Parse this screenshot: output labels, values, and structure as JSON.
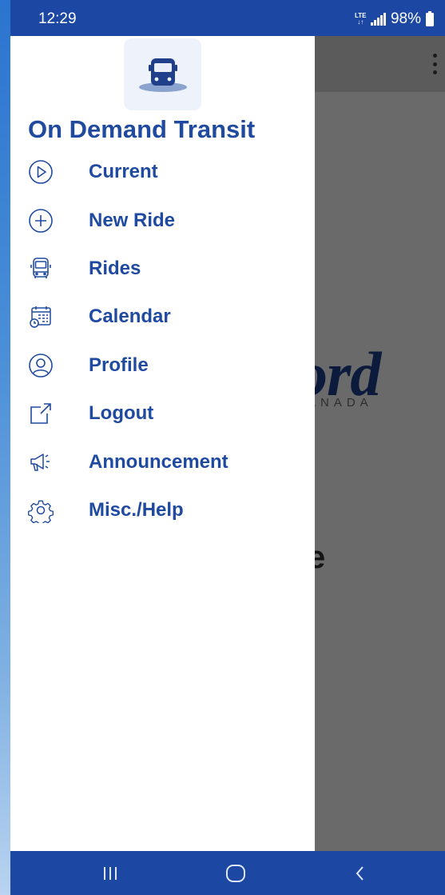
{
  "status_bar": {
    "time": "12:29",
    "network": "LTE",
    "battery": "98%"
  },
  "app_background": {
    "logo_text": "ord",
    "logo_subtext": "ANADA",
    "partial_text": "e"
  },
  "drawer": {
    "title": "On Demand Transit",
    "items": [
      {
        "label": "Current",
        "icon": "play-circle-icon"
      },
      {
        "label": "New Ride",
        "icon": "plus-circle-icon"
      },
      {
        "label": "Rides",
        "icon": "bus-icon"
      },
      {
        "label": "Calendar",
        "icon": "calendar-icon"
      },
      {
        "label": "Profile",
        "icon": "user-circle-icon"
      },
      {
        "label": "Logout",
        "icon": "external-link-icon"
      },
      {
        "label": "Announcement",
        "icon": "megaphone-icon"
      },
      {
        "label": "Misc./Help",
        "icon": "gear-icon"
      }
    ]
  },
  "colors": {
    "accent": "#1f4aa0",
    "status_bar": "#1c48a4",
    "drawer_bg": "#ffffff",
    "scrim": "#6a6a6a"
  }
}
